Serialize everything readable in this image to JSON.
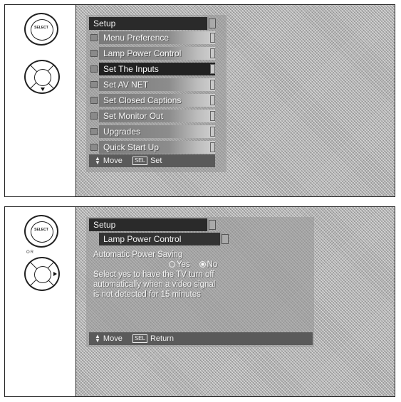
{
  "screen1": {
    "remote": {
      "select_label": "SELECT",
      "select_icon": "select-button-icon",
      "nav_icon": "nav-pad-down-icon"
    },
    "menu": {
      "title": "Setup",
      "items": [
        {
          "label": "Menu Preference",
          "selected": false
        },
        {
          "label": "Lamp Power Control",
          "selected": false
        },
        {
          "label": "Set The Inputs",
          "selected": true
        },
        {
          "label": "Set AV NET",
          "selected": false
        },
        {
          "label": "Set Closed Captions",
          "selected": false
        },
        {
          "label": "Set Monitor Out",
          "selected": false
        },
        {
          "label": "Upgrades",
          "selected": false
        },
        {
          "label": "Quick Start Up",
          "selected": false
        }
      ],
      "footer": {
        "move_label": "Move",
        "sel_key": "SEL",
        "action_label": "Set"
      }
    }
  },
  "screen2": {
    "remote": {
      "select_label": "SELECT",
      "or_label": "OR",
      "select_icon": "select-button-icon",
      "nav_icon": "nav-pad-right-icon"
    },
    "menu": {
      "title": "Setup",
      "subtitle": "Lamp Power Control",
      "option_label": "Automatic Power Saving",
      "options": [
        {
          "label": "Yes",
          "checked": false
        },
        {
          "label": "No",
          "checked": true
        }
      ],
      "description": [
        "Select yes to have the TV turn off",
        "automatically when a video signal",
        "is not detected for 15 minutes"
      ],
      "footer": {
        "move_label": "Move",
        "sel_key": "SEL",
        "action_label": "Return"
      }
    }
  }
}
